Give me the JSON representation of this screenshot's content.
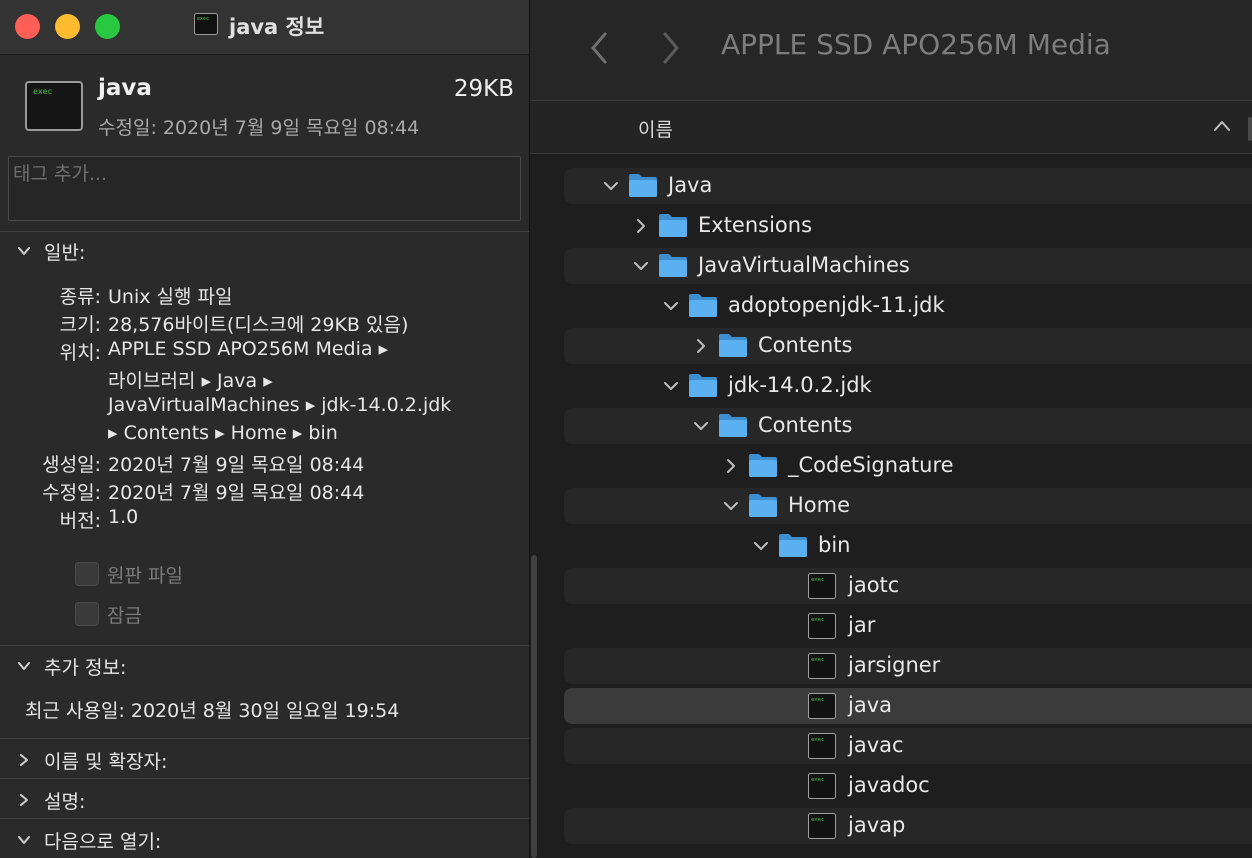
{
  "info_window": {
    "title": "java 정보",
    "file": {
      "name": "java",
      "size": "29KB",
      "modified_line": "수정일: 2020년 7월 9일 목요일 08:44",
      "icon_text": "exec"
    },
    "tags_placeholder": "태그 추가...",
    "general": {
      "header": "일반:",
      "kind_label": "종류:",
      "kind_value": "Unix 실행 파일",
      "size_label": "크기:",
      "size_value": "28,576바이트(디스크에 29KB 있음)",
      "where_label": "위치:",
      "where_lines": [
        "APPLE SSD APO256M Media ▸",
        "라이브러리 ▸ Java ▸",
        "JavaVirtualMachines ▸ jdk-14.0.2.jdk",
        "▸ Contents ▸ Home ▸ bin"
      ],
      "created_label": "생성일:",
      "created_value": "2020년 7월 9일 목요일 08:44",
      "modified_label": "수정일:",
      "modified_value": "2020년 7월 9일 목요일 08:44",
      "version_label": "버전:",
      "version_value": "1.0",
      "stationery_label": "원판 파일",
      "locked_label": "잠금"
    },
    "more_info": {
      "header": "추가 정보:",
      "last_opened": "최근 사용일: 2020년 8월 30일 일요일 19:54"
    },
    "name_ext_header": "이름 및 확장자:",
    "comments_header": "설명:",
    "open_with_header": "다음으로 열기:"
  },
  "finder": {
    "title": "APPLE SSD APO256M Media",
    "column_name": "이름",
    "rows": [
      {
        "label": "Java",
        "kind": "folder",
        "expanded": true
      },
      {
        "label": "Extensions",
        "kind": "folder",
        "expanded": false
      },
      {
        "label": "JavaVirtualMachines",
        "kind": "folder",
        "expanded": true
      },
      {
        "label": "adoptopenjdk-11.jdk",
        "kind": "folder",
        "expanded": true
      },
      {
        "label": "Contents",
        "kind": "folder",
        "expanded": false
      },
      {
        "label": "jdk-14.0.2.jdk",
        "kind": "folder",
        "expanded": true
      },
      {
        "label": "Contents",
        "kind": "folder",
        "expanded": true
      },
      {
        "label": "_CodeSignature",
        "kind": "folder",
        "expanded": false
      },
      {
        "label": "Home",
        "kind": "folder",
        "expanded": true
      },
      {
        "label": "bin",
        "kind": "folder",
        "expanded": true
      },
      {
        "label": "jaotc",
        "kind": "exec"
      },
      {
        "label": "jar",
        "kind": "exec"
      },
      {
        "label": "jarsigner",
        "kind": "exec"
      },
      {
        "label": "java",
        "kind": "exec",
        "selected": true
      },
      {
        "label": "javac",
        "kind": "exec"
      },
      {
        "label": "javadoc",
        "kind": "exec"
      },
      {
        "label": "javap",
        "kind": "exec"
      }
    ]
  },
  "colors": {
    "folder_blue": "#5ab0f0",
    "selection": "#3b3b3b",
    "traffic_red": "#ff5f57",
    "traffic_yellow": "#febc2e",
    "traffic_green": "#28c840"
  }
}
